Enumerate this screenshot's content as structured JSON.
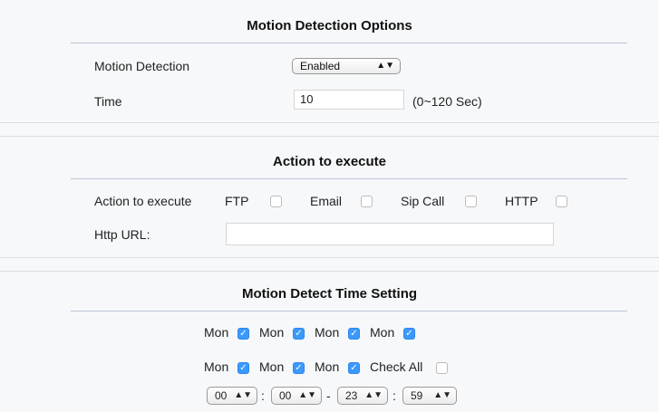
{
  "motion": {
    "title": "Motion Detection Options",
    "detection_label": "Motion Detection",
    "detection_value": "Enabled",
    "time_label": "Time",
    "time_value": "10",
    "time_hint": "(0~120 Sec)"
  },
  "action": {
    "title": "Action to execute",
    "row_label": "Action to execute",
    "options": [
      {
        "label": "FTP",
        "checked": false
      },
      {
        "label": "Email",
        "checked": false
      },
      {
        "label": "Sip Call",
        "checked": false
      },
      {
        "label": "HTTP",
        "checked": false
      }
    ],
    "url_label": "Http URL:",
    "url_value": ""
  },
  "schedule": {
    "title": "Motion Detect Time Setting",
    "days_row1": [
      {
        "label": "Mon",
        "checked": true
      },
      {
        "label": "Mon",
        "checked": true
      },
      {
        "label": "Mon",
        "checked": true
      },
      {
        "label": "Mon",
        "checked": true
      }
    ],
    "days_row2": [
      {
        "label": "Mon",
        "checked": true
      },
      {
        "label": "Mon",
        "checked": true
      },
      {
        "label": "Mon",
        "checked": true
      },
      {
        "label": "Check All",
        "checked": false
      }
    ],
    "start_hour": "00",
    "start_min": "00",
    "end_hour": "23",
    "end_min": "59",
    "colon": ":",
    "dash": "-"
  },
  "icons": {
    "select_arrows": "up-down-arrows",
    "checkmark": "✓"
  },
  "colors": {
    "checkbox_checked": "#3b99fc",
    "title_rule": "#b9c6d6",
    "section_bg": "#f6f8fa"
  }
}
